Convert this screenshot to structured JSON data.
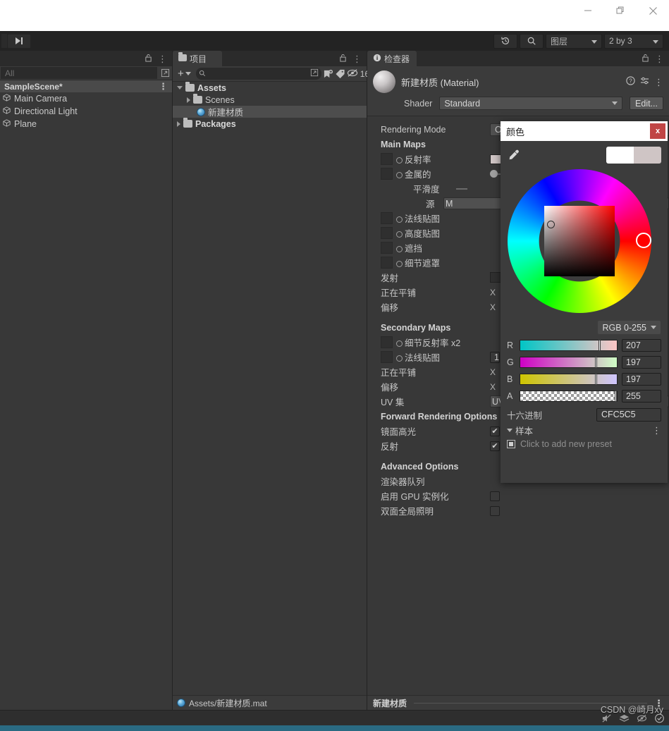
{
  "window": {
    "minimize_label": "minimize",
    "restore_label": "restore",
    "close_label": "close"
  },
  "toolbar": {
    "step_button": "step-button",
    "undo_history_icon": "undo-history-icon",
    "search_icon": "search-icon",
    "layers_label": "图层",
    "layout_label": "2 by 3"
  },
  "hierarchy": {
    "tab_label": "",
    "lock_icon": "lock-icon",
    "kebab_icon": "more-options-icon",
    "search_value": "",
    "search_placeholder": "All",
    "expand_icon": "expand-icon",
    "scene_name": "SampleScene*",
    "items": [
      {
        "label": "Main Camera",
        "icon": "gameobject-icon"
      },
      {
        "label": "Directional Light",
        "icon": "gameobject-icon"
      },
      {
        "label": "Plane",
        "icon": "gameobject-icon"
      }
    ]
  },
  "project": {
    "tab_label": "项目",
    "lock_icon": "lock-icon",
    "kebab_icon": "more-options-icon",
    "add_label": "+",
    "search_value": "",
    "search_placeholder": "",
    "favorite_icon": "save-search-icon",
    "label_icon": "tag-icon",
    "visibility_icon": "hidden-packages-icon",
    "count_label": "16",
    "tree": [
      {
        "label": "Assets",
        "depth": 0,
        "expanded": true,
        "icon": "folder-icon",
        "bold": true,
        "selected": false
      },
      {
        "label": "Scenes",
        "depth": 1,
        "expanded": false,
        "icon": "folder-icon",
        "bold": false,
        "selected": false
      },
      {
        "label": "新建材质",
        "depth": 2,
        "expanded": null,
        "icon": "material-icon",
        "bold": false,
        "selected": true
      },
      {
        "label": "Packages",
        "depth": 0,
        "expanded": false,
        "icon": "folder-icon",
        "bold": true,
        "selected": false
      }
    ],
    "status_path": "Assets/新建材质.mat",
    "status_icon": "material-icon"
  },
  "inspector": {
    "tab_label": "检查器",
    "tab_icon": "info-icon",
    "lock_icon": "lock-icon",
    "kebab_icon": "more-options-icon",
    "material_name": "新建材质 (Material)",
    "help_icon": "help-icon",
    "preset_icon": "preset-icon",
    "header_kebab_icon": "more-options-icon",
    "shader_label": "Shader",
    "shader_value": "Standard",
    "shader_edit_label": "Edit...",
    "rendering_mode_label": "Rendering Mode",
    "rendering_mode_value": "Opaque",
    "sections": {
      "main_maps": "Main Maps",
      "secondary_maps": "Secondary Maps",
      "forward_rendering": "Forward Rendering Options",
      "advanced_options": "Advanced Options"
    },
    "main_maps_rows": [
      {
        "label": "反射率",
        "type": "texture-color",
        "value": ""
      },
      {
        "label": "金属的",
        "type": "texture-slider",
        "value": ""
      },
      {
        "label": "平滑度",
        "type": "slider",
        "value": ""
      },
      {
        "label": "源",
        "type": "dropdown",
        "value": "M"
      },
      {
        "label": "法线贴图",
        "type": "texture",
        "value": ""
      },
      {
        "label": "高度贴图",
        "type": "texture",
        "value": ""
      },
      {
        "label": "遮挡",
        "type": "texture",
        "value": ""
      },
      {
        "label": "细节遮罩",
        "type": "texture",
        "value": ""
      },
      {
        "label": "发射",
        "type": "color",
        "value": ""
      },
      {
        "label": "正在平铺",
        "type": "vector2",
        "value": "X"
      },
      {
        "label": "偏移",
        "type": "vector2",
        "value": "X"
      }
    ],
    "secondary_maps_rows": [
      {
        "label": "细节反射率 x2",
        "type": "texture",
        "value": ""
      },
      {
        "label": "法线贴图",
        "type": "texture-number",
        "value": "1"
      },
      {
        "label": "正在平铺",
        "type": "vector2",
        "value": "X"
      },
      {
        "label": "偏移",
        "type": "vector2",
        "value": "X"
      },
      {
        "label": "UV 集",
        "type": "dropdown",
        "value": "UV"
      }
    ],
    "forward_rendering_rows": [
      {
        "label": "镜面高光",
        "type": "checkbox",
        "checked": true
      },
      {
        "label": "反射",
        "type": "checkbox",
        "checked": true
      }
    ],
    "advanced_rows": [
      {
        "label": "渲染器队列",
        "type": "empty",
        "checked": false
      },
      {
        "label": "启用 GPU 实例化",
        "type": "checkbox",
        "checked": false
      },
      {
        "label": "双面全局照明",
        "type": "checkbox",
        "checked": false
      }
    ],
    "preview_label": "新建材质"
  },
  "color_picker": {
    "title": "颜色",
    "close_label": "x",
    "eyedropper_icon": "eyedropper-icon",
    "old_color": "#FFFFFF",
    "new_color": "#CFC5C5",
    "hue_marker_color": "#FF0000",
    "mode_label": "RGB 0-255",
    "channels": [
      {
        "name": "R",
        "value": "207",
        "pct": 81.2
      },
      {
        "name": "G",
        "value": "197",
        "pct": 77.3
      },
      {
        "name": "B",
        "value": "197",
        "pct": 77.3
      },
      {
        "name": "A",
        "value": "255",
        "pct": 100
      }
    ],
    "hex_label": "十六进制",
    "hex_value": "CFC5C5",
    "samples_label": "样本",
    "samples_kebab_icon": "more-options-icon",
    "preset_placeholder": "Click to add new preset"
  },
  "statusbar": {
    "watermark": "CSDN @崎月xy",
    "icons": [
      "mute-audio-icon",
      "layers-stack-icon",
      "no-preview-icon",
      "check-circle-icon"
    ]
  }
}
